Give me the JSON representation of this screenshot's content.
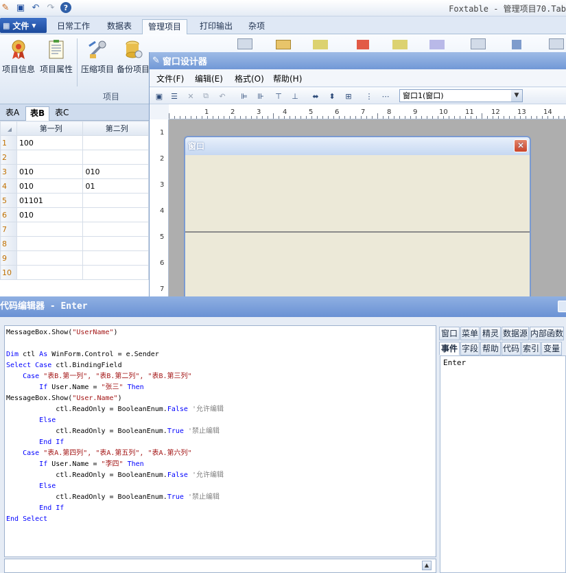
{
  "app": {
    "title": "Foxtable - 管理项目70.Tab",
    "file_menu": "文件"
  },
  "ribbon": {
    "tabs": [
      {
        "label": "日常工作"
      },
      {
        "label": "数据表"
      },
      {
        "label": "管理项目",
        "active": true
      },
      {
        "label": "打印输出"
      },
      {
        "label": "杂项"
      }
    ],
    "buttons": [
      {
        "label": "项目信息",
        "icon": "project-info-icon"
      },
      {
        "label": "项目属性",
        "icon": "project-properties-icon"
      },
      {
        "label": "压缩项目",
        "icon": "compress-project-icon"
      },
      {
        "label": "备份项目",
        "icon": "backup-project-icon"
      }
    ],
    "group_label": "项目"
  },
  "sheets": {
    "tabs": [
      {
        "label": "表A"
      },
      {
        "label": "表B",
        "active": true
      },
      {
        "label": "表C"
      }
    ],
    "columns": [
      "第一列",
      "第二列"
    ],
    "rows": [
      {
        "num": "1",
        "c1": "100",
        "c2": ""
      },
      {
        "num": "2",
        "c1": "",
        "c2": ""
      },
      {
        "num": "3",
        "c1": "010",
        "c2": "010"
      },
      {
        "num": "4",
        "c1": "010",
        "c2": "01"
      },
      {
        "num": "5",
        "c1": "01101",
        "c2": ""
      },
      {
        "num": "6",
        "c1": "010",
        "c2": ""
      },
      {
        "num": "7",
        "c1": "",
        "c2": ""
      },
      {
        "num": "8",
        "c1": "",
        "c2": ""
      },
      {
        "num": "9",
        "c1": "",
        "c2": ""
      },
      {
        "num": "10",
        "c1": "",
        "c2": ""
      }
    ]
  },
  "designer": {
    "title": "窗口设计器",
    "menu": [
      "文件(F)",
      "编辑(E)",
      "格式(O)",
      "帮助(H)"
    ],
    "window_select": "窗口1(窗口)",
    "ruler_h": [
      "1",
      "2",
      "3",
      "4",
      "5",
      "6",
      "7",
      "8",
      "9",
      "10",
      "11",
      "12",
      "13",
      "14"
    ],
    "ruler_v": [
      "1",
      "2",
      "3",
      "4",
      "5",
      "6",
      "7"
    ],
    "form_title": "窗口",
    "close_glyph": "✕"
  },
  "editor": {
    "title": "代码编辑器 - Enter",
    "code": [
      [
        [
          "",
          "MessageBox.Show("
        ],
        [
          "st",
          "\"UserName\""
        ],
        [
          "",
          ")"
        ]
      ],
      [
        [
          "",
          ""
        ]
      ],
      [
        [
          "kw",
          "Dim"
        ],
        [
          "",
          " ctl "
        ],
        [
          "kw",
          "As"
        ],
        [
          "",
          " WinForm.Control = e.Sender"
        ]
      ],
      [
        [
          "kw",
          "Select Case"
        ],
        [
          "",
          " ctl.BindingField"
        ]
      ],
      [
        [
          "",
          "    "
        ],
        [
          "kw",
          "Case"
        ],
        [
          "",
          " "
        ],
        [
          "st",
          "\"表B.第一列\", \"表B.第二列\", \"表B.第三列\""
        ]
      ],
      [
        [
          "",
          "        "
        ],
        [
          "kw",
          "If"
        ],
        [
          "",
          " User.Name = "
        ],
        [
          "st",
          "\"张三\""
        ],
        [
          "",
          " "
        ],
        [
          "kw",
          "Then"
        ]
      ],
      [
        [
          "",
          "MessageBox.Show("
        ],
        [
          "st",
          "\"User.Name\""
        ],
        [
          "",
          ")"
        ]
      ],
      [
        [
          "",
          "            ctl.ReadOnly = BooleanEnum."
        ],
        [
          "kw",
          "False"
        ],
        [
          "",
          " "
        ],
        [
          "cm",
          "'允许编辑"
        ]
      ],
      [
        [
          "",
          "        "
        ],
        [
          "kw",
          "Else"
        ]
      ],
      [
        [
          "",
          "            ctl.ReadOnly = BooleanEnum."
        ],
        [
          "kw",
          "True"
        ],
        [
          "",
          " "
        ],
        [
          "cm",
          "'禁止编辑"
        ]
      ],
      [
        [
          "",
          "        "
        ],
        [
          "kw",
          "End If"
        ]
      ],
      [
        [
          "",
          "    "
        ],
        [
          "kw",
          "Case"
        ],
        [
          "",
          " "
        ],
        [
          "st",
          "\"表A.第四列\", \"表A.第五列\", \"表A.第六列\""
        ]
      ],
      [
        [
          "",
          "        "
        ],
        [
          "kw",
          "If"
        ],
        [
          "",
          " User.Name = "
        ],
        [
          "st",
          "\"李四\""
        ],
        [
          "",
          " "
        ],
        [
          "kw",
          "Then"
        ]
      ],
      [
        [
          "",
          "            ctl.ReadOnly = BooleanEnum."
        ],
        [
          "kw",
          "False"
        ],
        [
          "",
          " "
        ],
        [
          "cm",
          "'允许编辑"
        ]
      ],
      [
        [
          "",
          "        "
        ],
        [
          "kw",
          "Else"
        ]
      ],
      [
        [
          "",
          "            ctl.ReadOnly = BooleanEnum."
        ],
        [
          "kw",
          "True"
        ],
        [
          "",
          " "
        ],
        [
          "cm",
          "'禁止编辑"
        ]
      ],
      [
        [
          "",
          "        "
        ],
        [
          "kw",
          "End If"
        ]
      ],
      [
        [
          "kw",
          "End Select"
        ]
      ]
    ],
    "side_tabs_row1": [
      "窗口",
      "菜单",
      "精灵",
      "数据源",
      "内部函数"
    ],
    "side_tabs_row2": [
      "事件",
      "字段",
      "帮助",
      "代码",
      "索引",
      "变量"
    ],
    "side_list": [
      "Enter"
    ]
  }
}
